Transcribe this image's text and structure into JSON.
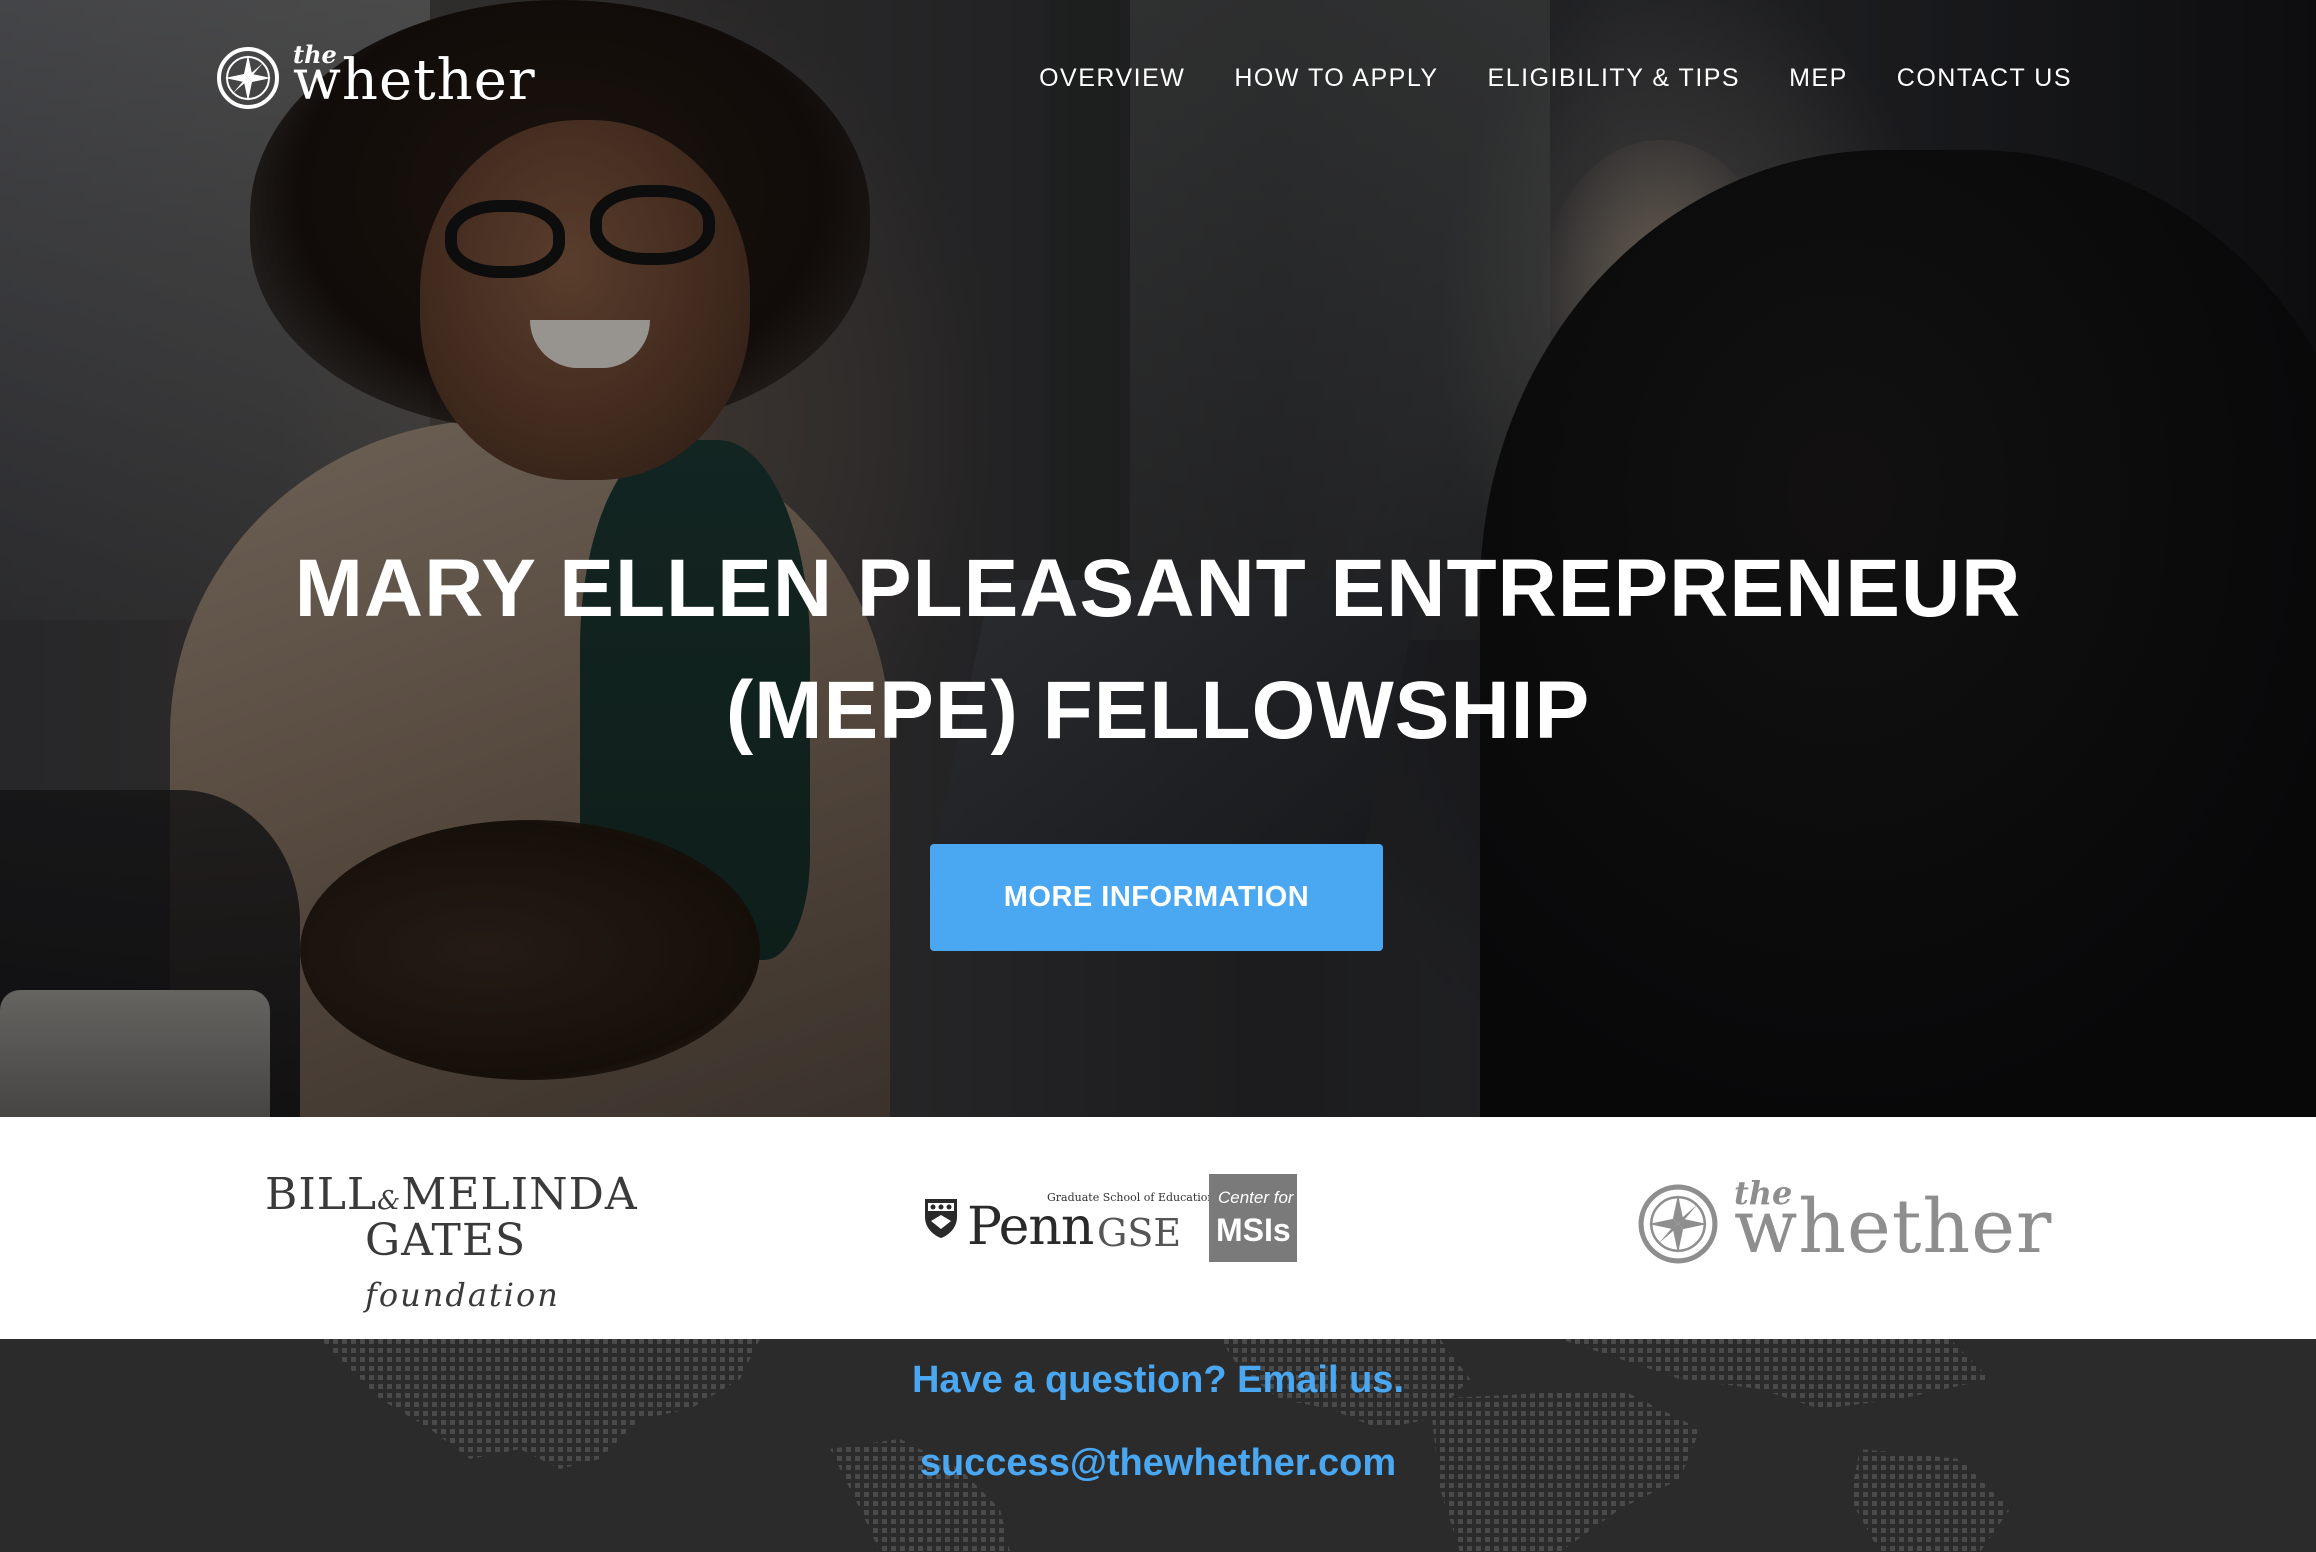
{
  "header": {
    "logo_the": "the",
    "logo_word": "whether",
    "nav": [
      {
        "label": "OVERVIEW"
      },
      {
        "label": "HOW TO APPLY"
      },
      {
        "label": "ELIGIBILITY & TIPS"
      },
      {
        "label": "MEP"
      },
      {
        "label": "CONTACT US"
      }
    ]
  },
  "hero": {
    "headline_line1": "MARY ELLEN PLEASANT ENTREPRENEUR",
    "headline_line2": "(MEPE) FELLOWSHIP",
    "cta_label": "MORE INFORMATION"
  },
  "partners": {
    "gates": {
      "line1_a": "BILL",
      "amp": "&",
      "line1_b": "MELINDA",
      "line2_a": "GATES",
      "line2_b": "foundation"
    },
    "penn": {
      "small": "Graduate School of Education",
      "word": "Penn",
      "gse": "GSE",
      "center_for": "Center for",
      "msis": "MSIs"
    },
    "whether": {
      "the": "the",
      "word": "whether"
    }
  },
  "footer": {
    "question": "Have a question? Email us.",
    "email": "success@thewhether.com"
  },
  "colors": {
    "accent": "#4aa7f2",
    "footer_bg": "#2b2b2b",
    "logo_gray": "#8e8e8e"
  },
  "icons": {
    "logo": "compass-icon",
    "penn_shield": "penn-shield-icon"
  }
}
